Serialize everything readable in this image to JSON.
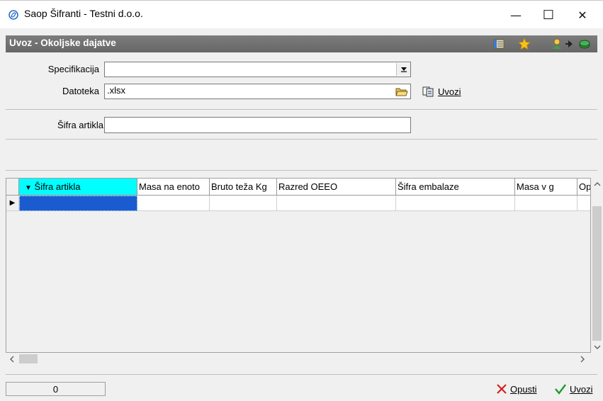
{
  "window": {
    "title": "Saop Šifranti - Testni d.o.o.",
    "minimize_glyph": "—",
    "maximize_glyph": "☐",
    "close_glyph": "✕"
  },
  "header": {
    "title": "Uvoz - Okoljske dajatve",
    "icons": [
      "list-icon",
      "star-icon",
      "user-arrow-icon",
      "forward-arrow-icon",
      "money-icon"
    ]
  },
  "form": {
    "specifikacija_label": "Specifikacija",
    "specifikacija_value": "",
    "datoteka_label": "Datoteka",
    "datoteka_value": ".xlsx",
    "uvozi_file_button": "Uvozi",
    "sifra_artikla_label": "Šifra artikla",
    "sifra_artikla_value": ""
  },
  "grid": {
    "sort_indicator": "▼",
    "columns": [
      "Šifra artikla",
      "Masa na enoto",
      "Bruto teža Kg",
      "Razred OEEO",
      "Šifra embalaze",
      "Masa v g",
      "Op"
    ],
    "row_indicator": "▶",
    "selected_cell_color": "#1a5ccf",
    "sorted_header_color": "#00ffff"
  },
  "scroll": {
    "up": "^",
    "down": "v",
    "left": "<",
    "right": ">"
  },
  "status": {
    "count": "0"
  },
  "footer": {
    "cancel_label": "Opusti",
    "import_label": "Uvozi"
  }
}
